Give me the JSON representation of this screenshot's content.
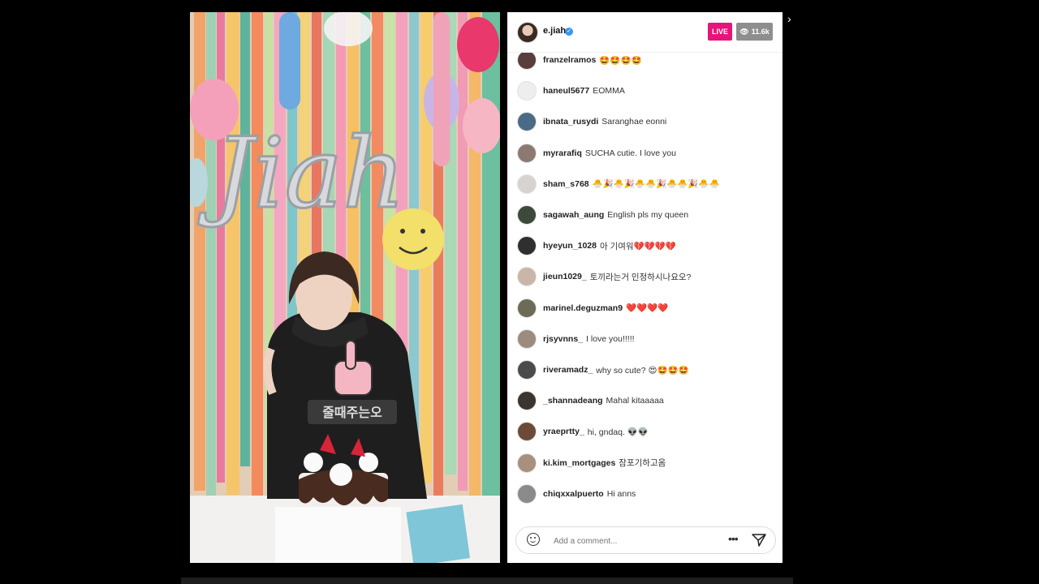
{
  "stream": {
    "username": "e.jiah",
    "live_label": "LIVE",
    "viewers": "11.6k",
    "close_icon": "chevron-right-icon"
  },
  "video": {
    "balloon_text": "Jiah",
    "topper_text": "줄때주는오"
  },
  "comments": [
    {
      "user": "franzelramos",
      "text": "🤩🤩🤩🤩",
      "avatar_color": "#5a3d3d"
    },
    {
      "user": "haneul5677",
      "text": "EOMMA",
      "avatar_color": "#eeeeee"
    },
    {
      "user": "ibnata_rusydi",
      "text": "Saranghae eonni",
      "avatar_color": "#4a6b86"
    },
    {
      "user": "myrarafiq",
      "text": "SUCHA cutie. I love you",
      "avatar_color": "#8c7a72"
    },
    {
      "user": "sham_s768",
      "text": "🐣🎉🐣🎉🐣🐣🎉🐣🐣🎉🐣🐣",
      "avatar_color": "#d9d3cf"
    },
    {
      "user": "sagawah_aung",
      "text": "English pls my queen",
      "avatar_color": "#3d4a3a"
    },
    {
      "user": "hyeyun_1028",
      "text": "아 기여워💔💔💔💔",
      "avatar_color": "#2f2f2f"
    },
    {
      "user": "jieun1029_",
      "text": "토끼라는거 인정하시나요오?",
      "avatar_color": "#c9b6a8"
    },
    {
      "user": "marinel.deguzman9",
      "text": "❤️❤️❤️❤️",
      "avatar_color": "#6d6a58"
    },
    {
      "user": "rjsyvnns_",
      "text": "I love you!!!!!",
      "avatar_color": "#9c8b7e"
    },
    {
      "user": "riveramadz_",
      "text": "why so cute? 😍🤩🤩🤩",
      "avatar_color": "#4b4b4b"
    },
    {
      "user": "_shannadeang",
      "text": "Mahal kitaaaaa",
      "avatar_color": "#3a3530"
    },
    {
      "user": "yraeprtty_",
      "text": "hi, gndaq. 👽👽",
      "avatar_color": "#6b4b36"
    },
    {
      "user": "ki.kim_mortgages",
      "text": "잠포기하고옴",
      "avatar_color": "#a98f7e"
    },
    {
      "user": "chiqxxalpuerto",
      "text": "Hi anns",
      "avatar_color": "#8a8a8a"
    }
  ],
  "comment_bar": {
    "placeholder": "Add a comment...",
    "more_label": "•••"
  }
}
